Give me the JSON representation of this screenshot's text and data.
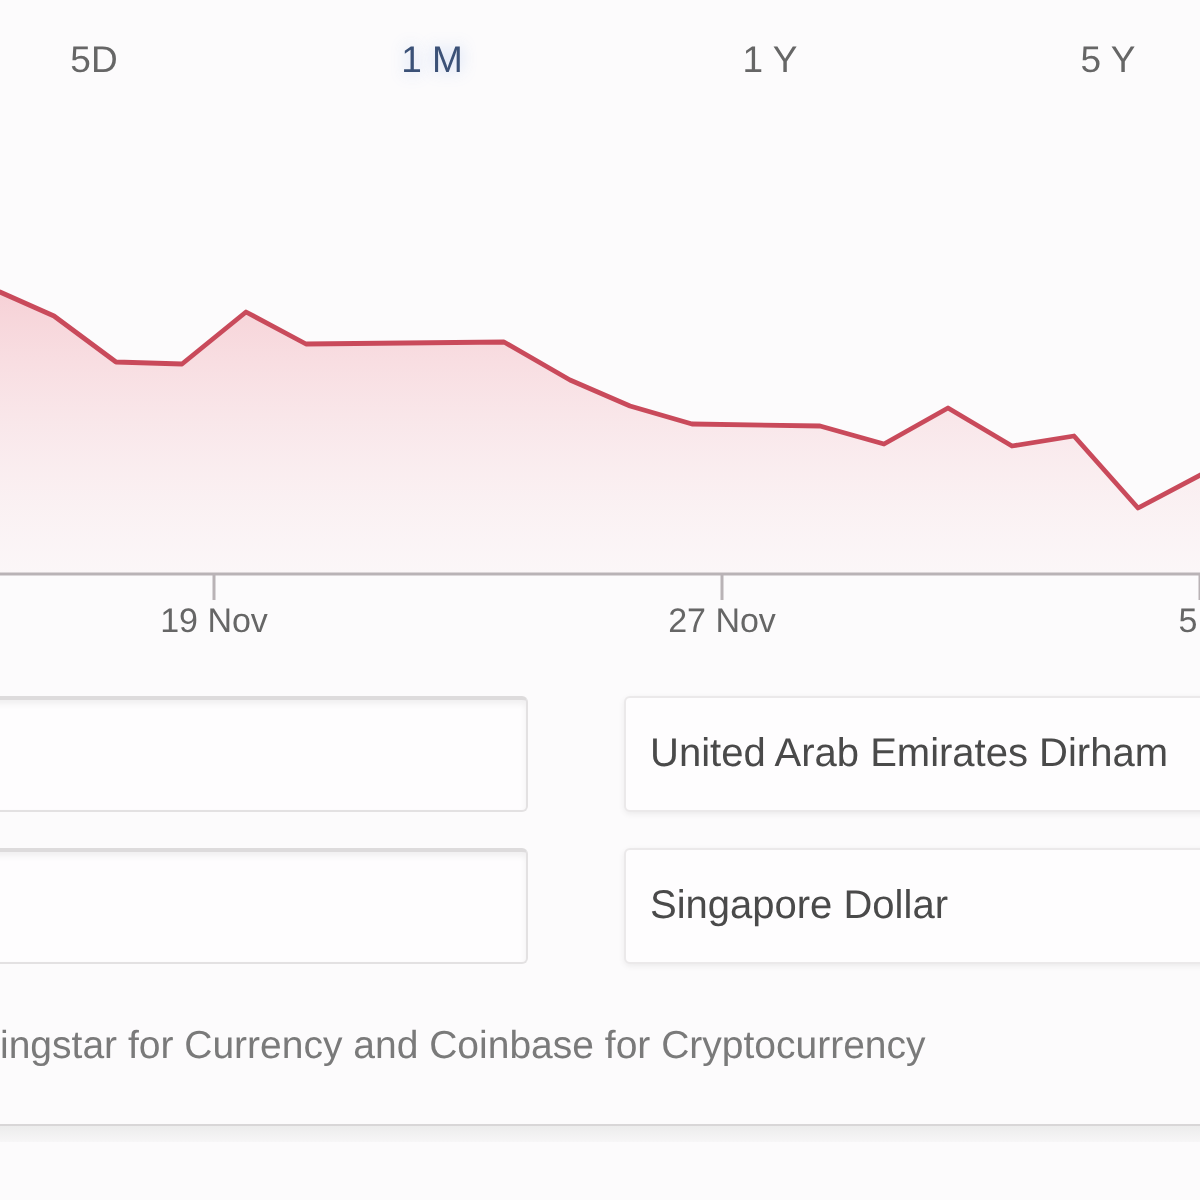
{
  "tabs": [
    {
      "label": "5D",
      "selected": false
    },
    {
      "label": "1 M",
      "selected": true
    },
    {
      "label": "1 Y",
      "selected": false
    },
    {
      "label": "5 Y",
      "selected": false
    }
  ],
  "chart": {
    "axis_labels": [
      "19 Nov",
      "27 Nov",
      "5"
    ]
  },
  "converter": {
    "rows": [
      {
        "currency": "United Arab Emirates Dirham"
      },
      {
        "currency": "Singapore Dollar"
      }
    ]
  },
  "footer": {
    "text": "ingstar for Currency and Coinbase for Cryptocurrency"
  }
}
